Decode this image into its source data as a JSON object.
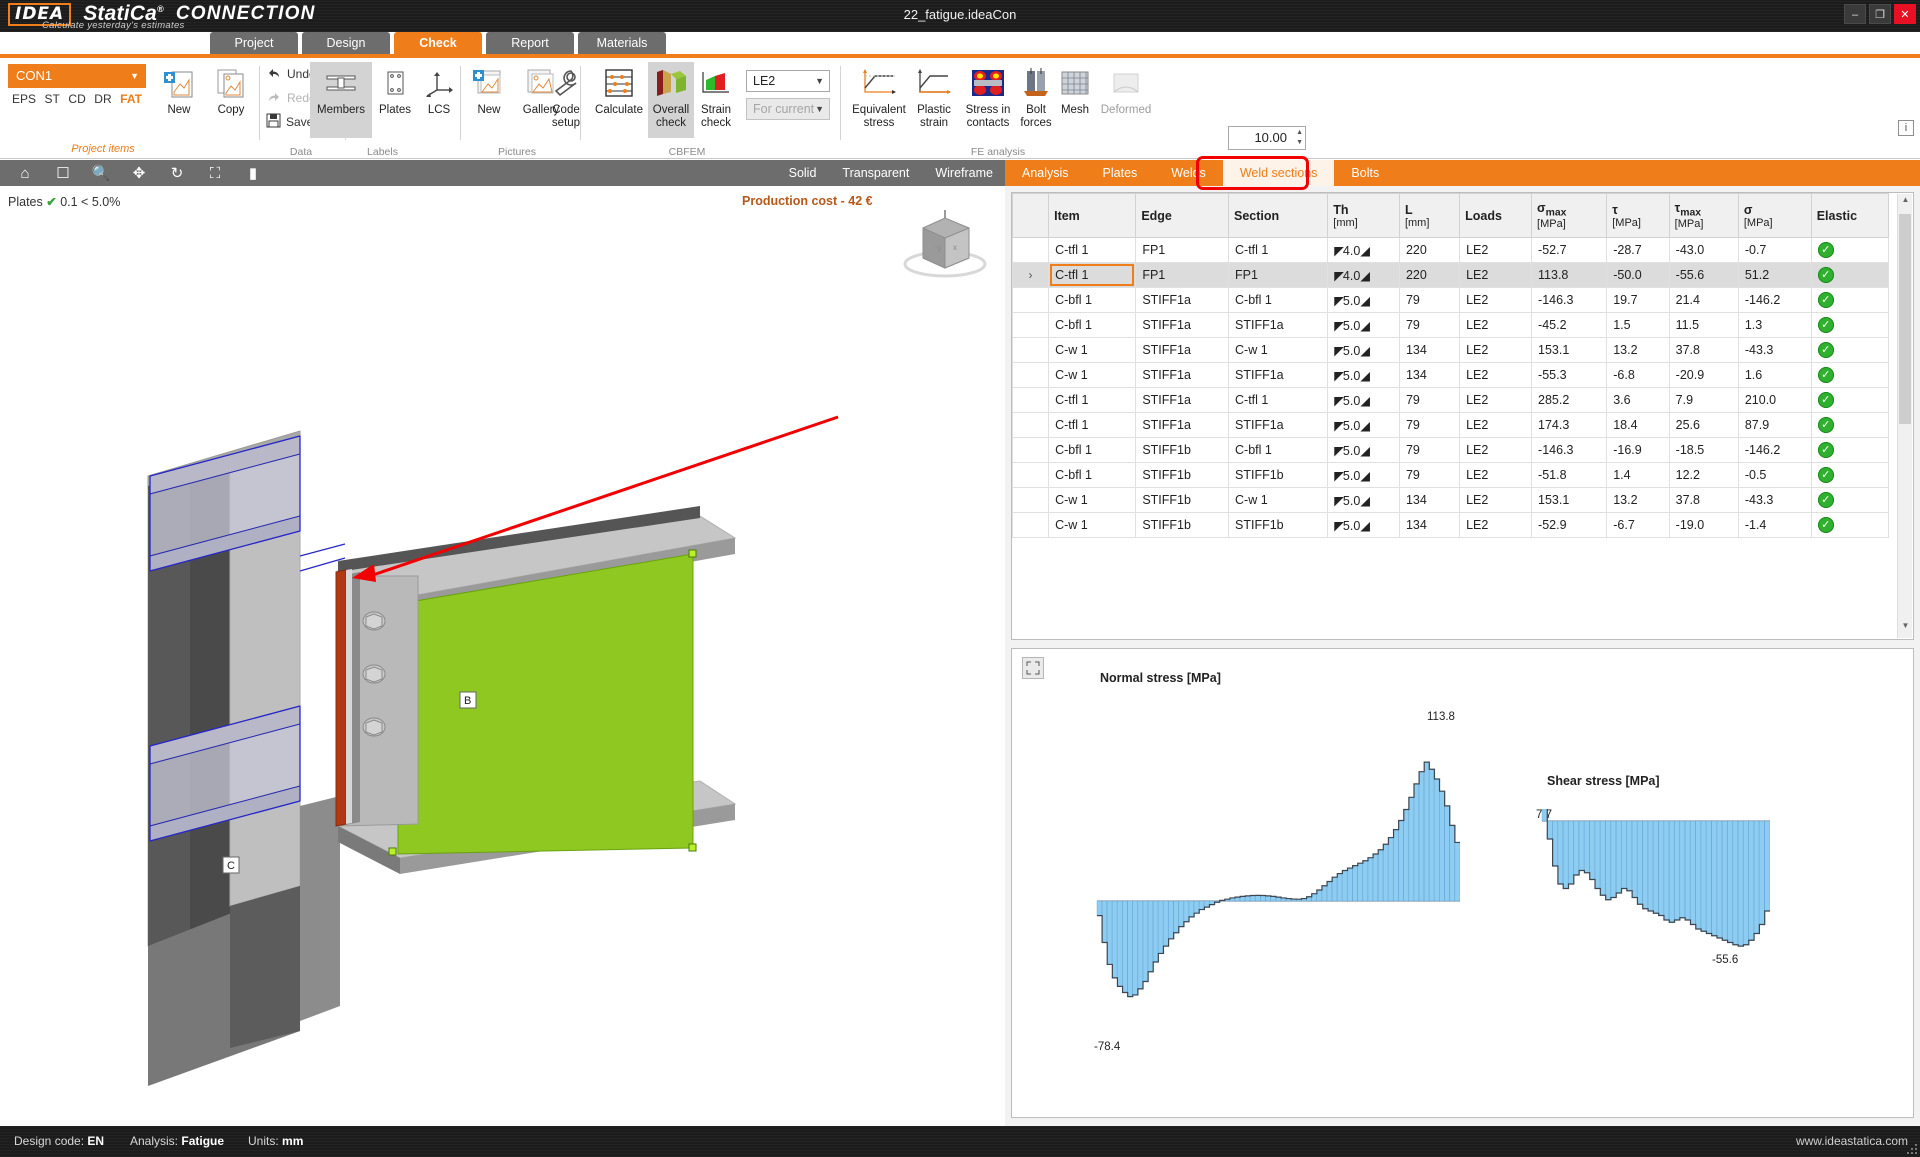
{
  "titlebar": {
    "brand_badge": "IDEA",
    "brand_name": "StatiCa",
    "brand_sup": "®",
    "product": "CONNECTION",
    "tagline": "Calculate yesterday's estimates",
    "document_title": "22_fatigue.ideaCon",
    "minimize": "–",
    "maximize": "❐",
    "close": "✕"
  },
  "main_tabs": [
    {
      "label": "Project",
      "active": false
    },
    {
      "label": "Design",
      "active": false
    },
    {
      "label": "Check",
      "active": true
    },
    {
      "label": "Report",
      "active": false
    },
    {
      "label": "Materials",
      "active": false
    }
  ],
  "ribbon": {
    "connection_combo": {
      "value": "CON1",
      "caret": "▼"
    },
    "abbr": [
      "EPS",
      "ST",
      "CD",
      "DR",
      "FAT"
    ],
    "project_items_label": "Project items",
    "new_button": "New",
    "copy_button": "Copy",
    "undo": "Undo",
    "redo": "Redo",
    "save": "Save",
    "group_data": "Data",
    "members": "Members",
    "plates": "Plates",
    "lcs": "LCS",
    "group_labels": "Labels",
    "pic_new": "New",
    "pic_gallery": "Gallery",
    "group_pictures": "Pictures",
    "code_setup": "Code\nsetup",
    "code_setup_l1": "Code",
    "code_setup_l2": "setup",
    "calculate": "Calculate",
    "overall_check_l1": "Overall",
    "overall_check_l2": "check",
    "strain_check_l1": "Strain",
    "strain_check_l2": "check",
    "load_combo": {
      "value": "LE2",
      "caret": "▼"
    },
    "for_current_combo": {
      "value": "For current",
      "caret": "▼"
    },
    "group_cbfem": "CBFEM",
    "equivalent_stress_l1": "Equivalent",
    "equivalent_stress_l2": "stress",
    "plastic_strain_l1": "Plastic",
    "plastic_strain_l2": "strain",
    "stress_contacts_l1": "Stress in",
    "stress_contacts_l2": "contacts",
    "bolt_forces_l1": "Bolt",
    "bolt_forces_l2": "forces",
    "mesh": "Mesh",
    "deformed": "Deformed",
    "scale_value": "10.00",
    "group_fe": "FE analysis",
    "info": "i"
  },
  "viewport": {
    "toolbar_icons": [
      "home-icon",
      "pan-fit-icon",
      "zoom-icon",
      "move-icon",
      "rotate-icon",
      "fullscreen-icon",
      "section-icon"
    ],
    "view_modes": [
      "Solid",
      "Transparent",
      "Wireframe"
    ],
    "plates_label": "Plates",
    "plates_status": "✔",
    "plates_value": "0.1 < 5.0%",
    "production_cost_label": "Production cost",
    "production_cost_value": "- 42 €",
    "member_label_b": "B",
    "member_label_c": "C"
  },
  "sub_tabs": [
    {
      "label": "Analysis",
      "active": false
    },
    {
      "label": "Plates",
      "active": false
    },
    {
      "label": "Welds",
      "active": false
    },
    {
      "label": "Weld sections",
      "active": true
    },
    {
      "label": "Bolts",
      "active": false
    }
  ],
  "table": {
    "columns": [
      {
        "label": "",
        "unit": ""
      },
      {
        "label": "Item",
        "unit": ""
      },
      {
        "label": "Edge",
        "unit": ""
      },
      {
        "label": "Section",
        "unit": ""
      },
      {
        "label": "Th",
        "unit": "[mm]"
      },
      {
        "label": "L",
        "unit": "[mm]"
      },
      {
        "label": "Loads",
        "unit": ""
      },
      {
        "label": "σmax",
        "unit": "[MPa]"
      },
      {
        "label": "τ",
        "unit": "[MPa]"
      },
      {
        "label": "τmax",
        "unit": "[MPa]"
      },
      {
        "label": "σ",
        "unit": "[MPa]"
      },
      {
        "label": "Elastic",
        "unit": ""
      }
    ],
    "rows": [
      {
        "arrow": "",
        "item": "C-tfl 1",
        "edge": "FP1",
        "section": "C-tfl 1",
        "th": "4.0",
        "l": "220",
        "loads": "LE2",
        "sigma_max": "-52.7",
        "tau": "-28.7",
        "tau_max": "-43.0",
        "sigma": "-0.7",
        "elastic": "✓",
        "selected": false
      },
      {
        "arrow": "›",
        "item": "C-tfl 1",
        "edge": "FP1",
        "section": "FP1",
        "th": "4.0",
        "l": "220",
        "loads": "LE2",
        "sigma_max": "113.8",
        "tau": "-50.0",
        "tau_max": "-55.6",
        "sigma": "51.2",
        "elastic": "✓",
        "selected": true
      },
      {
        "arrow": "",
        "item": "C-bfl 1",
        "edge": "STIFF1a",
        "section": "C-bfl 1",
        "th": "5.0",
        "l": "79",
        "loads": "LE2",
        "sigma_max": "-146.3",
        "tau": "19.7",
        "tau_max": "21.4",
        "sigma": "-146.2",
        "elastic": "✓",
        "selected": false
      },
      {
        "arrow": "",
        "item": "C-bfl 1",
        "edge": "STIFF1a",
        "section": "STIFF1a",
        "th": "5.0",
        "l": "79",
        "loads": "LE2",
        "sigma_max": "-45.2",
        "tau": "1.5",
        "tau_max": "11.5",
        "sigma": "1.3",
        "elastic": "✓",
        "selected": false
      },
      {
        "arrow": "",
        "item": "C-w 1",
        "edge": "STIFF1a",
        "section": "C-w 1",
        "th": "5.0",
        "l": "134",
        "loads": "LE2",
        "sigma_max": "153.1",
        "tau": "13.2",
        "tau_max": "37.8",
        "sigma": "-43.3",
        "elastic": "✓",
        "selected": false
      },
      {
        "arrow": "",
        "item": "C-w 1",
        "edge": "STIFF1a",
        "section": "STIFF1a",
        "th": "5.0",
        "l": "134",
        "loads": "LE2",
        "sigma_max": "-55.3",
        "tau": "-6.8",
        "tau_max": "-20.9",
        "sigma": "1.6",
        "elastic": "✓",
        "selected": false
      },
      {
        "arrow": "",
        "item": "C-tfl 1",
        "edge": "STIFF1a",
        "section": "C-tfl 1",
        "th": "5.0",
        "l": "79",
        "loads": "LE2",
        "sigma_max": "285.2",
        "tau": "3.6",
        "tau_max": "7.9",
        "sigma": "210.0",
        "elastic": "✓",
        "selected": false
      },
      {
        "arrow": "",
        "item": "C-tfl 1",
        "edge": "STIFF1a",
        "section": "STIFF1a",
        "th": "5.0",
        "l": "79",
        "loads": "LE2",
        "sigma_max": "174.3",
        "tau": "18.4",
        "tau_max": "25.6",
        "sigma": "87.9",
        "elastic": "✓",
        "selected": false
      },
      {
        "arrow": "",
        "item": "C-bfl 1",
        "edge": "STIFF1b",
        "section": "C-bfl 1",
        "th": "5.0",
        "l": "79",
        "loads": "LE2",
        "sigma_max": "-146.3",
        "tau": "-16.9",
        "tau_max": "-18.5",
        "sigma": "-146.2",
        "elastic": "✓",
        "selected": false
      },
      {
        "arrow": "",
        "item": "C-bfl 1",
        "edge": "STIFF1b",
        "section": "STIFF1b",
        "th": "5.0",
        "l": "79",
        "loads": "LE2",
        "sigma_max": "-51.8",
        "tau": "1.4",
        "tau_max": "12.2",
        "sigma": "-0.5",
        "elastic": "✓",
        "selected": false
      },
      {
        "arrow": "",
        "item": "C-w 1",
        "edge": "STIFF1b",
        "section": "C-w 1",
        "th": "5.0",
        "l": "134",
        "loads": "LE2",
        "sigma_max": "153.1",
        "tau": "13.2",
        "tau_max": "37.8",
        "sigma": "-43.3",
        "elastic": "✓",
        "selected": false
      },
      {
        "arrow": "",
        "item": "C-w 1",
        "edge": "STIFF1b",
        "section": "STIFF1b",
        "th": "5.0",
        "l": "134",
        "loads": "LE2",
        "sigma_max": "-52.9",
        "tau": "-6.7",
        "tau_max": "-19.0",
        "sigma": "-1.4",
        "elastic": "✓",
        "selected": false
      }
    ]
  },
  "chart_data": [
    {
      "type": "area",
      "title": "Normal stress [MPa]",
      "xlabel": "",
      "ylabel": "",
      "max_label": "113.8",
      "min_label": "-78.4",
      "ylim": [
        -78.4,
        113.8
      ],
      "values": [
        -12,
        -34,
        -52,
        -63,
        -70,
        -75,
        -78.4,
        -77,
        -72,
        -66,
        -58,
        -50,
        -43,
        -37,
        -31,
        -26,
        -21,
        -17,
        -13,
        -10,
        -7,
        -5,
        -3,
        -1,
        0.5,
        1.5,
        2.5,
        3.2,
        3.8,
        4.2,
        4.5,
        4.6,
        4.5,
        4.2,
        3.8,
        3.2,
        2.5,
        2.0,
        1.6,
        1.5,
        2.0,
        3.5,
        6.0,
        9.0,
        12.5,
        16.0,
        19.5,
        22.5,
        25.0,
        27.0,
        29.0,
        31.0,
        33.0,
        35.5,
        38.5,
        42.0,
        46.5,
        52.0,
        58.5,
        66.0,
        75.0,
        85.0,
        96.0,
        106.0,
        113.8,
        108.0,
        100.0,
        90.0,
        78.0,
        62.0,
        48.0
      ]
    },
    {
      "type": "area",
      "title": "Shear stress [MPa]",
      "xlabel": "",
      "ylabel": "",
      "max_label": "7.7",
      "min_label": "-55.6",
      "ylim": [
        -55.6,
        7.7
      ],
      "values": [
        7.7,
        -8,
        -20,
        -28,
        -30,
        -28,
        -24,
        -22,
        -23,
        -26,
        -30,
        -33,
        -35,
        -34,
        -32,
        -30,
        -31,
        -34,
        -37,
        -39,
        -40,
        -41,
        -42,
        -44,
        -45,
        -44,
        -43,
        -44,
        -46,
        -48,
        -49,
        -50,
        -51,
        -52,
        -53,
        -54,
        -55,
        -55.6,
        -55.0,
        -53.0,
        -50.0,
        -46.0,
        -40.0
      ]
    }
  ],
  "statusbar": {
    "design_code_label": "Design code:",
    "design_code_value": "EN",
    "analysis_label": "Analysis:",
    "analysis_value": "Fatigue",
    "units_label": "Units:",
    "units_value": "mm",
    "website": "www.ideastatica.com"
  }
}
